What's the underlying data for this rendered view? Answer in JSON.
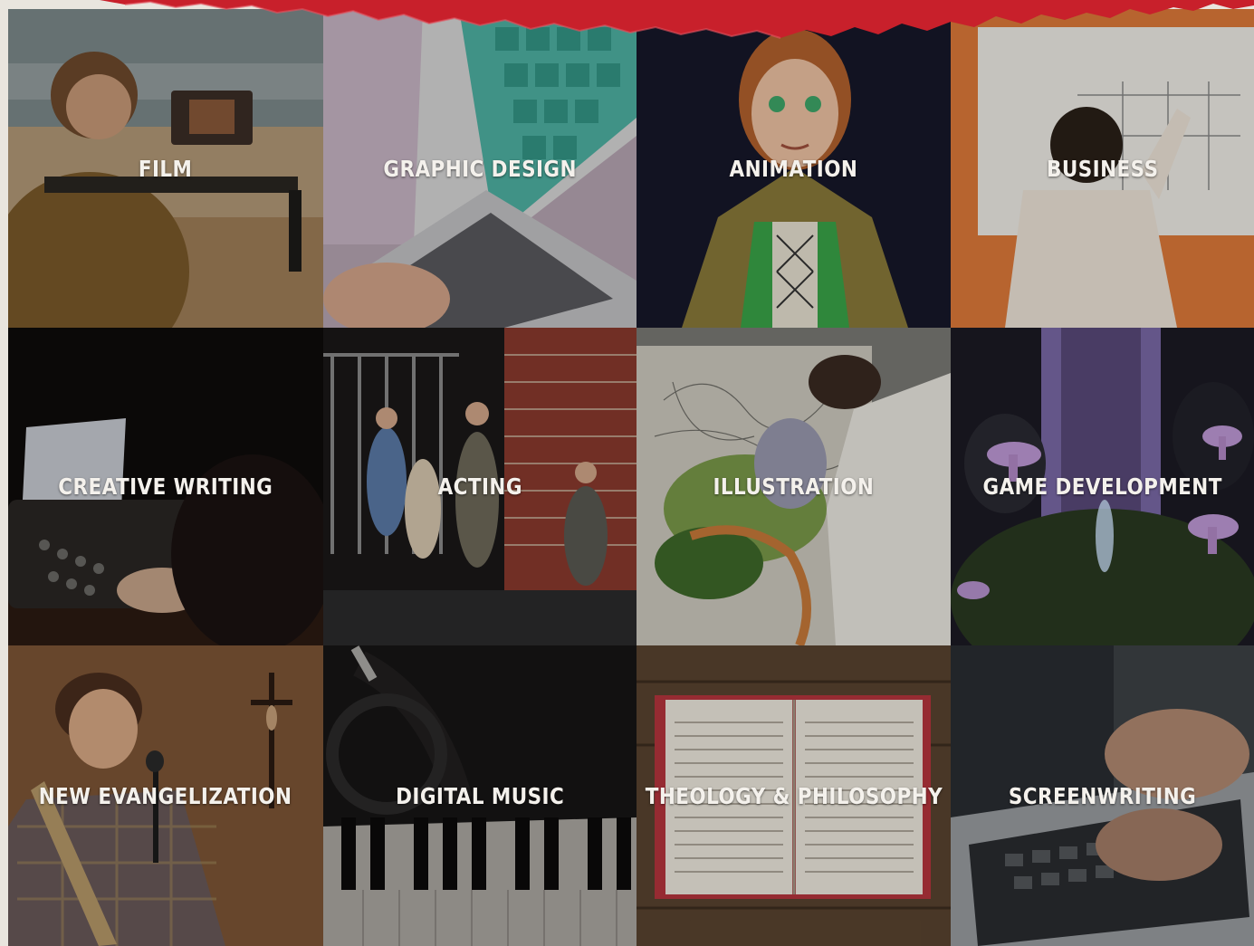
{
  "colors": {
    "banner_red": "#c8202b",
    "label_text": "#f4f1ec",
    "page_bg": "#e9e5de"
  },
  "programs": [
    {
      "label": "FILM",
      "theme": "film-camera-beach"
    },
    {
      "label": "GRAPHIC DESIGN",
      "theme": "laptop-design"
    },
    {
      "label": "ANIMATION",
      "theme": "animated-character"
    },
    {
      "label": "BUSINESS",
      "theme": "whiteboard-planning"
    },
    {
      "label": "CREATIVE WRITING",
      "theme": "typewriter"
    },
    {
      "label": "ACTING",
      "theme": "stage-performance"
    },
    {
      "label": "ILLUSTRATION",
      "theme": "sketchbook-drawing"
    },
    {
      "label": "GAME DEVELOPMENT",
      "theme": "fantasy-game-scene"
    },
    {
      "label": "NEW EVANGELIZATION",
      "theme": "guitarist-crucifix"
    },
    {
      "label": "DIGITAL MUSIC",
      "theme": "piano-keys-headphones"
    },
    {
      "label": "THEOLOGY & PHILOSOPHY",
      "theme": "open-bible"
    },
    {
      "label": "SCREENWRITING",
      "theme": "typing-laptop"
    }
  ]
}
